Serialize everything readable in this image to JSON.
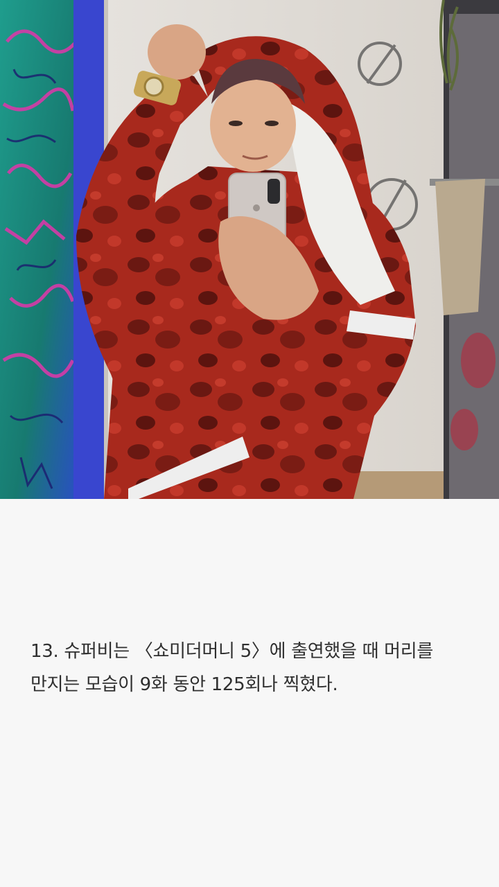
{
  "photo": {
    "alt": "",
    "colors": {
      "jacket": "#a6281c",
      "jacket_dark": "#5a1410",
      "left_wall": "#1d8c7f",
      "blue_strip": "#3c4cd8",
      "back_wall": "#e4e0da",
      "phone": "#c8c2be",
      "towel": "#efefec"
    }
  },
  "caption": {
    "text": "13. 슈퍼비는 〈쇼미더머니 5〉에 출연했을 때 머리를 만지는 모습이 9화 동안 125회나 찍혔다."
  }
}
